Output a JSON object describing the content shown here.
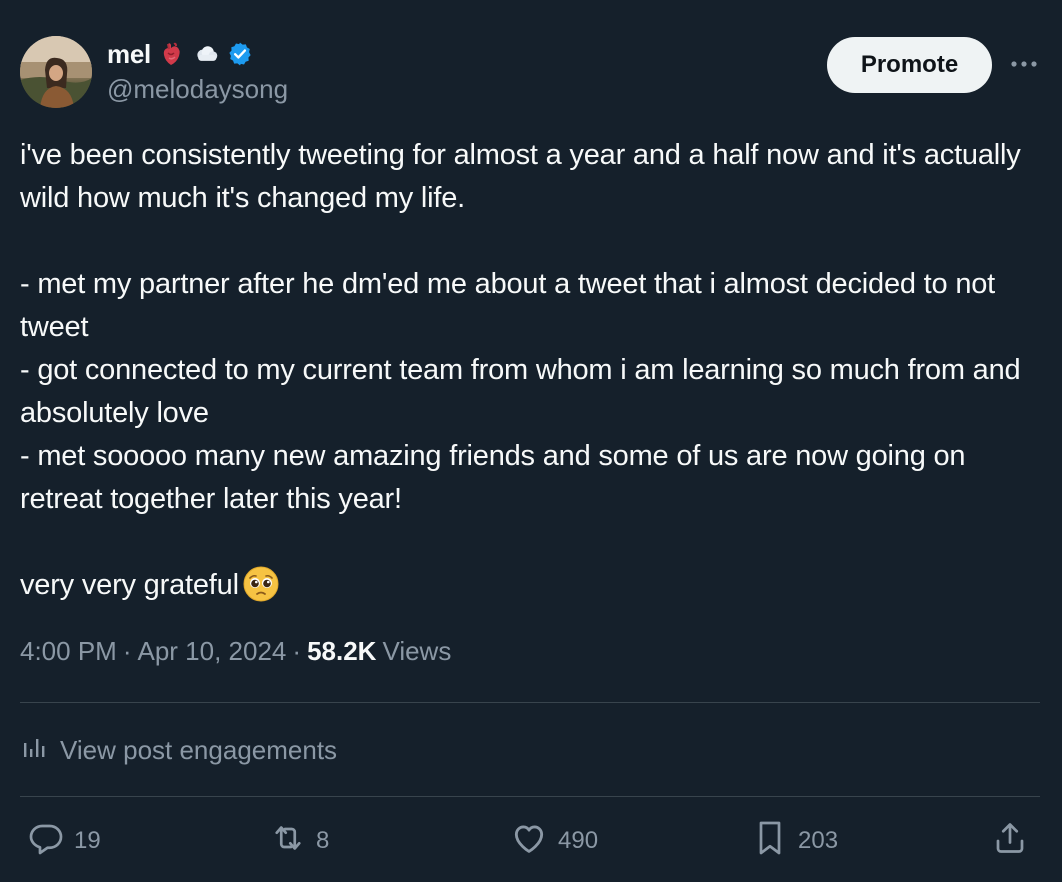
{
  "author": {
    "display_name": "mel",
    "handle": "@melodaysong",
    "badges": [
      "anatomical-heart-icon",
      "cloud-icon",
      "verified-badge-icon"
    ]
  },
  "header": {
    "promote_label": "Promote",
    "more_icon": "more-horizontal-icon"
  },
  "tweet": {
    "line_1": "i've been consistently tweeting for almost a year and a half now and it's actually wild how much it's changed my life.",
    "line_2": "- met my partner after he dm'ed me about a tweet that i almost decided to not tweet",
    "line_3": "- got connected to my current team from whom i am learning so much from and absolutely love",
    "line_4": "- met sooooo many new amazing friends and some of us are now going on retreat together later this year!",
    "line_5": "very very grateful",
    "trailing_emoji": "pleading-face-icon"
  },
  "meta": {
    "time": "4:00 PM",
    "separator": "·",
    "date": "Apr 10, 2024",
    "views_count": "58.2K",
    "views_label": "Views"
  },
  "engagements": {
    "label": "View post engagements",
    "icon": "analytics-icon"
  },
  "actions": {
    "replies": "19",
    "reposts": "8",
    "likes": "490",
    "bookmarks": "203"
  },
  "colors": {
    "background": "#15202b",
    "text": "#f7f9f9",
    "secondary_text": "#8b98a5",
    "divider": "#38444d",
    "verified": "#1d9bf0",
    "promote_bg": "#eff3f4"
  }
}
